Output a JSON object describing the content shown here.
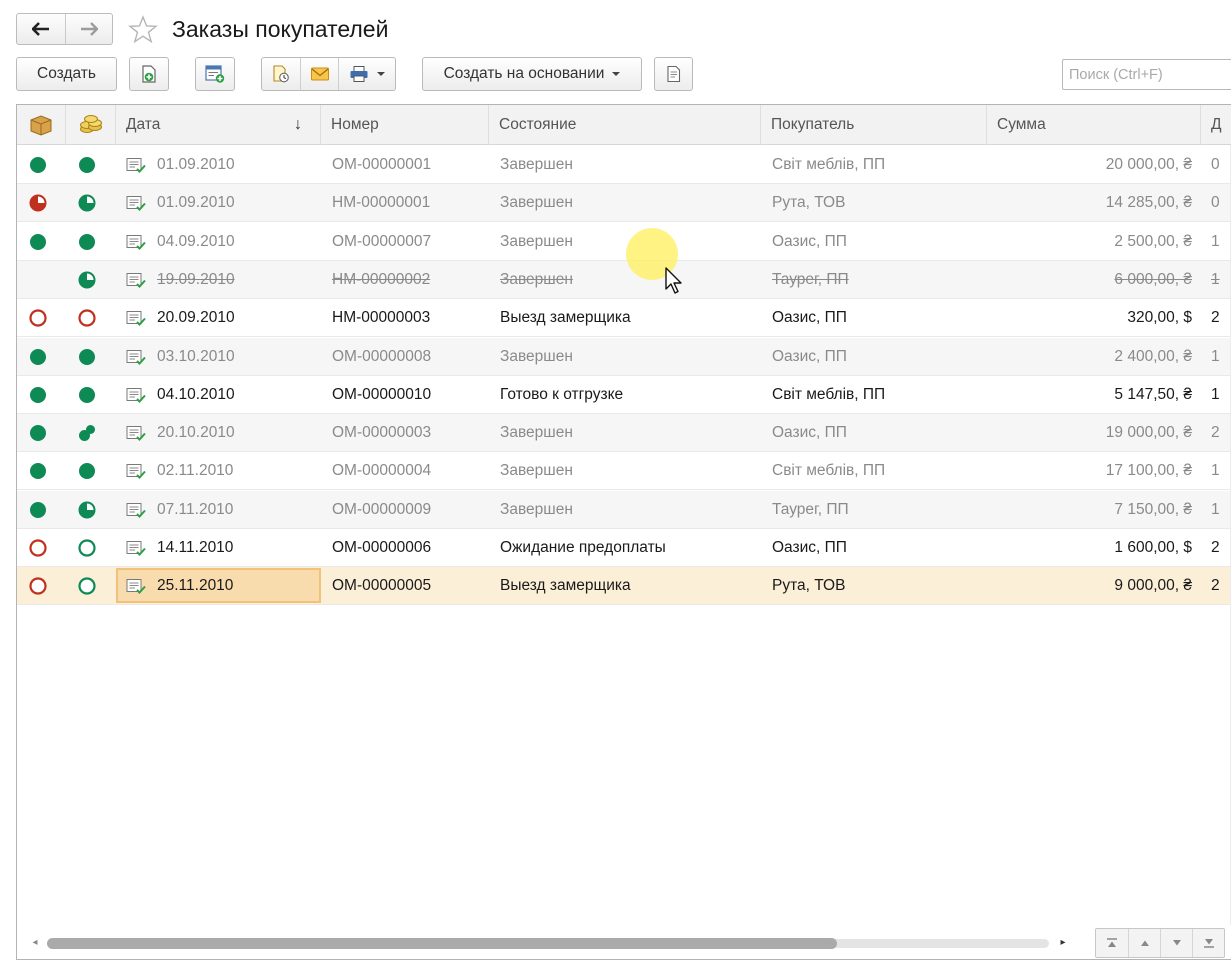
{
  "window": {
    "title": "Заказы покупателей"
  },
  "nav": {
    "back_icon": "arrow-left-icon",
    "forward_icon": "arrow-right-icon",
    "favorite_icon": "star-icon"
  },
  "toolbar": {
    "create_label": "Создать",
    "create_based_on_label": "Создать на основании",
    "icons": [
      "copy-add-icon",
      "list-add-icon",
      "report-clock-icon",
      "mail-icon",
      "print-icon",
      "document-icon"
    ]
  },
  "search": {
    "placeholder": "Поиск (Ctrl+F)"
  },
  "table": {
    "columns": {
      "col_shipment_icon": "box-icon",
      "col_payment_icon": "coins-icon",
      "date": "Дата",
      "number": "Номер",
      "state": "Состояние",
      "customer": "Покупатель",
      "sum": "Сумма",
      "overflow": "Д"
    },
    "sort_indicator": "↓",
    "rows": [
      {
        "ship": "full",
        "pay": "full",
        "date": "01.09.2010",
        "number": "ОМ-00000001",
        "state": "Завершен",
        "customer": "Світ меблів, ПП",
        "sum": "20 000,00, ₴",
        "extra": "0",
        "style": "muted"
      },
      {
        "ship": "partial-red",
        "pay": "partial-green",
        "date": "01.09.2010",
        "number": "НМ-00000001",
        "state": "Завершен",
        "customer": "Рута, ТОВ",
        "sum": "14 285,00, ₴",
        "extra": "0",
        "style": "muted"
      },
      {
        "ship": "full",
        "pay": "full",
        "date": "04.09.2010",
        "number": "ОМ-00000007",
        "state": "Завершен",
        "customer": "Оазис, ПП",
        "sum": "2 500,00, ₴",
        "extra": "1",
        "style": "muted"
      },
      {
        "ship": "none",
        "pay": "partial-green",
        "date": "19.09.2010",
        "number": "НМ-00000002",
        "state": "Завершен",
        "customer": "Таурег, ПП",
        "sum": "6 000,00, ₴",
        "extra": "1",
        "style": "strike"
      },
      {
        "ship": "empty-red",
        "pay": "empty-red",
        "date": "20.09.2010",
        "number": "НМ-00000003",
        "state": "Выезд замерщика",
        "customer": "Оазис, ПП",
        "sum": "320,00, $",
        "extra": "2",
        "style": "active"
      },
      {
        "ship": "full",
        "pay": "full",
        "date": "03.10.2010",
        "number": "ОМ-00000008",
        "state": "Завершен",
        "customer": "Оазис, ПП",
        "sum": "2 400,00, ₴",
        "extra": "1",
        "style": "muted"
      },
      {
        "ship": "full",
        "pay": "full",
        "date": "04.10.2010",
        "number": "ОМ-00000010",
        "state": "Готово к отгрузке",
        "customer": "Світ меблів, ПП",
        "sum": "5 147,50, ₴",
        "extra": "1",
        "style": "active"
      },
      {
        "ship": "full",
        "pay": "split",
        "date": "20.10.2010",
        "number": "ОМ-00000003",
        "state": "Завершен",
        "customer": "Оазис, ПП",
        "sum": "19 000,00, ₴",
        "extra": "2",
        "style": "muted"
      },
      {
        "ship": "full",
        "pay": "full",
        "date": "02.11.2010",
        "number": "ОМ-00000004",
        "state": "Завершен",
        "customer": "Світ меблів, ПП",
        "sum": "17 100,00, ₴",
        "extra": "1",
        "style": "muted"
      },
      {
        "ship": "full",
        "pay": "partial-green",
        "date": "07.11.2010",
        "number": "ОМ-00000009",
        "state": "Завершен",
        "customer": "Таурег, ПП",
        "sum": "7 150,00, ₴",
        "extra": "1",
        "style": "muted"
      },
      {
        "ship": "empty-red",
        "pay": "empty-green",
        "date": "14.11.2010",
        "number": "ОМ-00000006",
        "state": "Ожидание предоплаты",
        "customer": "Оазис, ПП",
        "sum": "1 600,00, $",
        "extra": "2",
        "style": "active"
      },
      {
        "ship": "empty-red",
        "pay": "empty-green",
        "date": "25.11.2010",
        "number": "ОМ-00000005",
        "state": "Выезд замерщика",
        "customer": "Рута, ТОВ",
        "sum": "9 000,00, ₴",
        "extra": "2",
        "style": "active",
        "selected": true
      }
    ]
  },
  "pager": {
    "icons": [
      "first-page-icon",
      "page-up-icon",
      "page-down-icon",
      "last-page-icon"
    ]
  },
  "colors": {
    "green": "#0e8a55",
    "red": "#c0301f",
    "selection": "#fcefd8",
    "focus": "#f9dcae"
  }
}
